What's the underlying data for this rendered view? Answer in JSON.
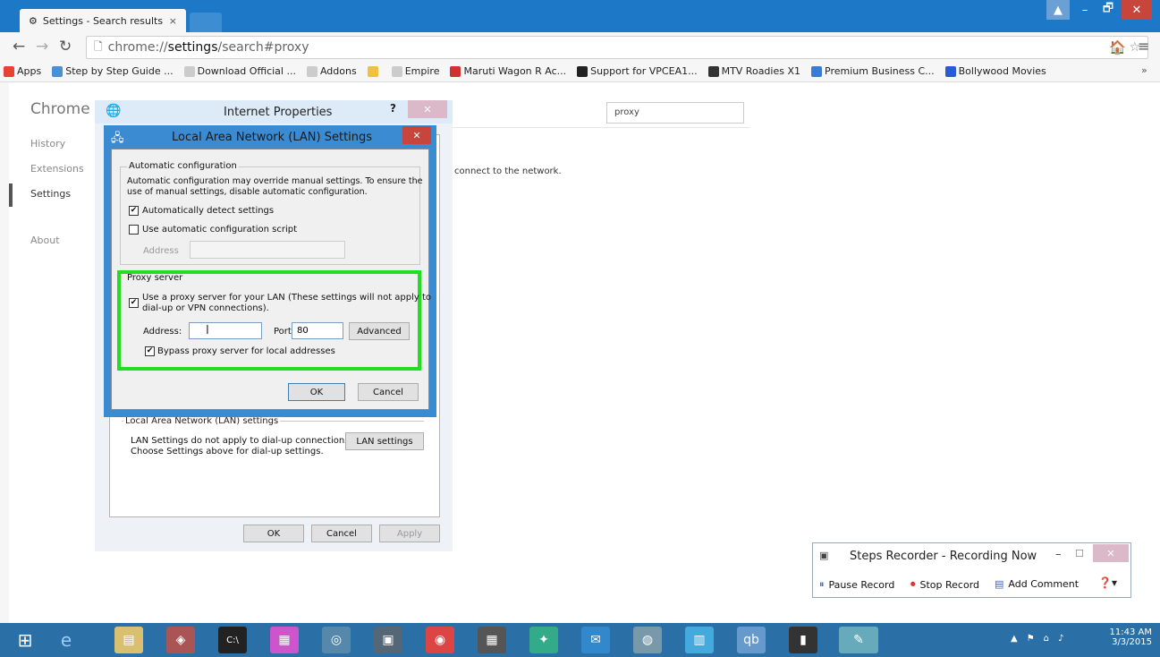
{
  "tab": {
    "title": "Settings - Search results",
    "close": "×"
  },
  "window": {
    "minimize": "–",
    "restore": "🗗",
    "close": "✕"
  },
  "omnibox": {
    "prefix": "chrome://",
    "bold": "settings",
    "rest": "/search#proxy"
  },
  "bookmarks": [
    {
      "label": "Apps",
      "color": "#e94235"
    },
    {
      "label": "Step by Step Guide ...",
      "color": "#4a90d9"
    },
    {
      "label": "Download Official ...",
      "color": "#cccccc"
    },
    {
      "label": "Addons",
      "color": "#cccccc"
    },
    {
      "label": "",
      "color": "#f0c040"
    },
    {
      "label": "Empire",
      "color": "#cccccc"
    },
    {
      "label": "Maruti Wagon R Ac...",
      "color": "#d03030"
    },
    {
      "label": "Support for VPCEA1...",
      "color": "#222222"
    },
    {
      "label": "MTV Roadies X1",
      "color": "#333333"
    },
    {
      "label": "Premium Business C...",
      "color": "#3a7bd5"
    },
    {
      "label": "Bollywood Movies",
      "color": "#2a5bd7"
    }
  ],
  "bookmark_more": "»",
  "sidebar": {
    "title": "Chrome",
    "items": [
      "History",
      "Extensions",
      "Settings",
      "About"
    ]
  },
  "search": {
    "value": "proxy"
  },
  "page_text": "connect to the network.",
  "inet": {
    "title": "Internet Properties",
    "help": "?",
    "close": "✕",
    "lan_group": "Local Area Network (LAN) settings",
    "lan_text1": "LAN Settings do not apply to dial-up connections.",
    "lan_text2": "Choose Settings above for dial-up settings.",
    "lan_button": "LAN settings",
    "ok": "OK",
    "cancel": "Cancel",
    "apply": "Apply"
  },
  "lan": {
    "title": "Local Area Network (LAN) Settings",
    "close": "✕",
    "auto_group": "Automatic configuration",
    "auto_text1": "Automatic configuration may override manual settings.  To ensure the",
    "auto_text2": "use of manual settings, disable automatic configuration.",
    "auto_detect": "Automatically detect settings",
    "auto_detect_checked": true,
    "auto_script": "Use automatic configuration script",
    "auto_script_checked": false,
    "address_label": "Address",
    "proxy_group": "Proxy server",
    "proxy_use1": "Use a proxy server for your LAN (These settings will not apply to",
    "proxy_use2": "dial-up or VPN connections).",
    "proxy_use_checked": true,
    "proxy_address_label": "Address:",
    "proxy_address_value": "",
    "port_label": "Port:",
    "port_value": "80",
    "advanced": "Advanced",
    "bypass": "Bypass proxy server for local addresses",
    "bypass_checked": true,
    "ok": "OK",
    "cancel": "Cancel",
    "highlight_color": "#22dd22"
  },
  "steps": {
    "title": "Steps Recorder - Recording Now",
    "pause": "Pause Record",
    "stop": "Stop Record",
    "comment": "Add Comment",
    "help": "?"
  },
  "clock": {
    "time": "11:43 AM",
    "date": "3/3/2015"
  }
}
